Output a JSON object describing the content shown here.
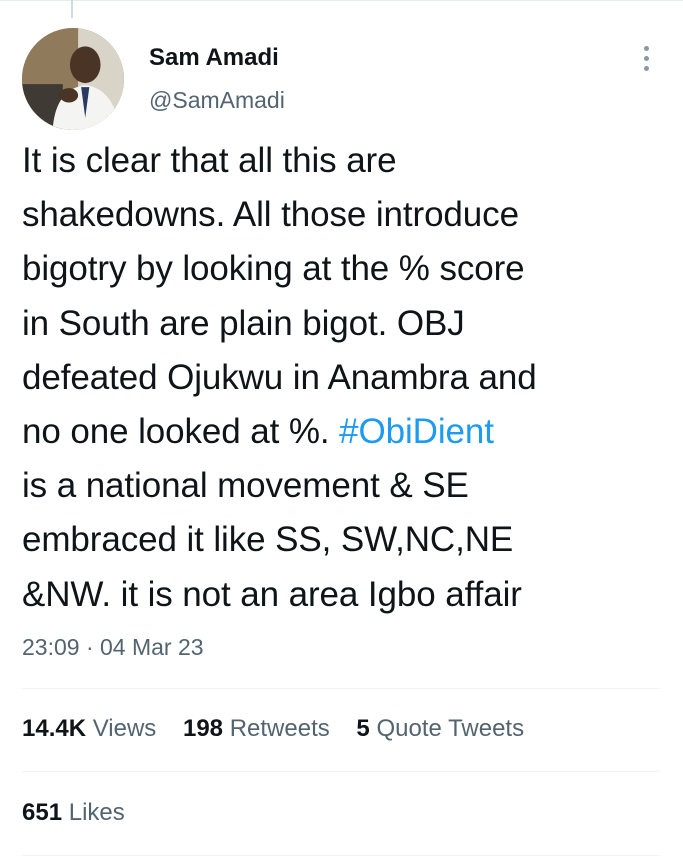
{
  "tweet": {
    "author_name": "Sam Amadi",
    "author_handle": "@SamAmadi",
    "text_lines": [
      "It is clear that all this are",
      "shakedowns. All those introduce",
      "bigotry by looking at the % score",
      "in South are plain bigot. OBJ",
      "defeated Ojukwu in Anambra and",
      "no one looked at %. ",
      "is a national movement & SE",
      "embraced it like SS, SW,NC,NE",
      "&NW. it is not an area Igbo affair"
    ],
    "hashtag": "#ObiDient",
    "timestamp": "23:09 · 04 Mar 23"
  },
  "stats": {
    "views_count": "14.4K",
    "views_label": "Views",
    "retweets_count": "198",
    "retweets_label": "Retweets",
    "quotes_count": "5",
    "quotes_label": "Quote Tweets",
    "likes_count": "651",
    "likes_label": "Likes"
  },
  "colors": {
    "link": "#1d9bf0",
    "secondary_text": "#536471",
    "primary_text": "#0f1419"
  },
  "icons": {
    "more": "more-vertical-icon"
  }
}
